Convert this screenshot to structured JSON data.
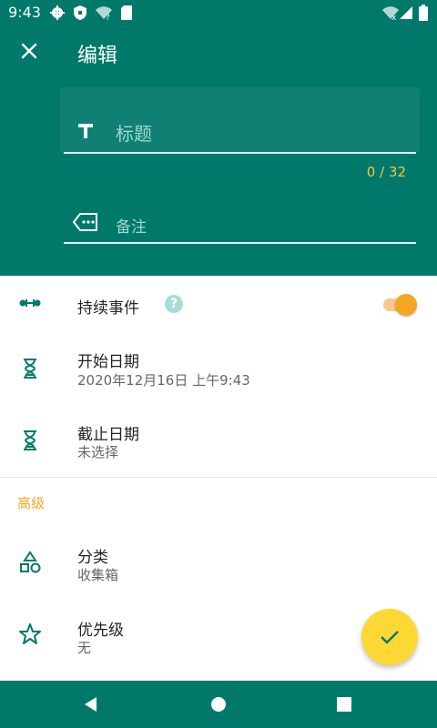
{
  "status": {
    "time": "9:43"
  },
  "header": {
    "title": "编辑",
    "title_placeholder": "标题",
    "char_counter": "0 / 32",
    "note_placeholder": "备注"
  },
  "rows": {
    "continuous_event": {
      "label": "持续事件",
      "help": "?",
      "switch_on": true
    },
    "start_date": {
      "label": "开始日期",
      "value": "2020年12月16日 上午9:43"
    },
    "end_date": {
      "label": "截止日期",
      "value": "未选择"
    },
    "section_advanced": "高级",
    "category": {
      "label": "分类",
      "value": "收集箱"
    },
    "priority": {
      "label": "优先级",
      "value": "无"
    }
  },
  "colors": {
    "primary": "#00796b",
    "accent": "#f5a623",
    "fab": "#fdd835",
    "counter": "#f5c542"
  }
}
